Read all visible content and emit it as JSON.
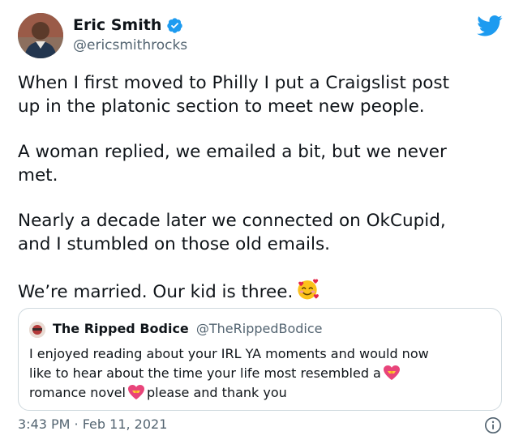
{
  "author": {
    "display_name": "Eric Smith",
    "handle": "@ericsmithrocks",
    "verified": true
  },
  "tweet": {
    "paragraphs": [
      "When I first moved to Philly I put a Craigslist post\nup in the platonic section to meet new people.",
      "A woman replied, we emailed a bit, but we never\nmet.",
      "Nearly a decade later we connected on OkCupid,\nand I stumbled on those old emails.",
      "We’re married. Our kid is three."
    ],
    "emoji": "smiling-face-with-hearts"
  },
  "quoted_tweet": {
    "display_name": "The Ripped Bodice",
    "handle": "@TheRippedBodice",
    "line1": "I enjoyed reading about your IRL YA  moments and would now",
    "line2": "like to hear about the time your life most resembled a",
    "line3_a": "romance novel",
    "line3_b": "please and thank you",
    "emoji": "heart-with-ribbon"
  },
  "meta": {
    "timestamp": "3:43 PM · Feb 11, 2021"
  },
  "colors": {
    "twitter_blue": "#1d9bf0",
    "text": "#0f1419",
    "secondary": "#536471",
    "border": "#cfd9de"
  },
  "icons": [
    "twitter-bird-icon",
    "verified-badge-icon",
    "info-icon"
  ]
}
